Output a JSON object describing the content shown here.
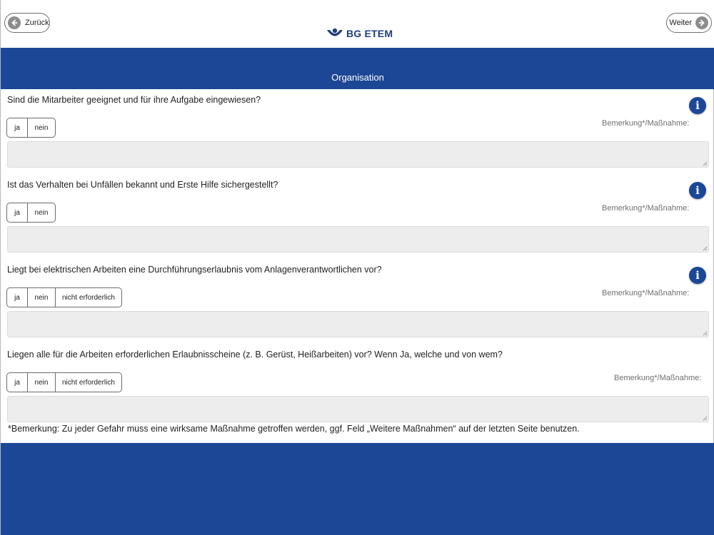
{
  "header": {
    "back_label": "Zurück",
    "next_label": "Weiter",
    "logo_text": "BG ETEM"
  },
  "section": {
    "title": "Organisation"
  },
  "questions": [
    {
      "text": "Sind die Mitarbeiter geeignet und für ihre Aufgabe eingewiesen?",
      "options": [
        "ja",
        "nein"
      ],
      "remark_label": "Bemerkung*/Maßnahme:",
      "has_info": true,
      "remark_value": ""
    },
    {
      "text": "Ist das Verhalten bei Unfällen bekannt und Erste Hilfe sichergestellt?",
      "options": [
        "ja",
        "nein"
      ],
      "remark_label": "Bemerkung*/Maßnahme:",
      "has_info": true,
      "remark_value": ""
    },
    {
      "text": "Liegt bei elektrischen Arbeiten eine Durchführungserlaubnis vom Anlagenverantwortlichen vor?",
      "options": [
        "ja",
        "nein",
        "nicht erforderlich"
      ],
      "remark_label": "Bemerkung*/Maßnahme:",
      "has_info": true,
      "remark_value": ""
    },
    {
      "text": "Liegen alle für die Arbeiten erforderlichen Erlaubnisscheine (z. B. Gerüst, Heißarbeiten) vor? Wenn Ja, welche und von wem?",
      "options": [
        "ja",
        "nein",
        "nicht erforderlich"
      ],
      "remark_label": "Bemerkung*/Maßnahme:",
      "has_info": false,
      "remark_value": ""
    }
  ],
  "info_icon_glyph": "i",
  "footnote": "*Bemerkung: Zu jeder Gefahr muss eine wirksame Maßnahme getroffen werden, ggf. Feld „Weitere Maßnahmen“ auf der letzten Seite benutzen.",
  "colors": {
    "brand_blue": "#1c4796",
    "field_gray": "#ededed"
  },
  "icons": {
    "back": "arrow-left-circle-icon",
    "next": "arrow-right-circle-icon",
    "info": "info-icon",
    "logo": "bg-etem-logo-icon"
  }
}
